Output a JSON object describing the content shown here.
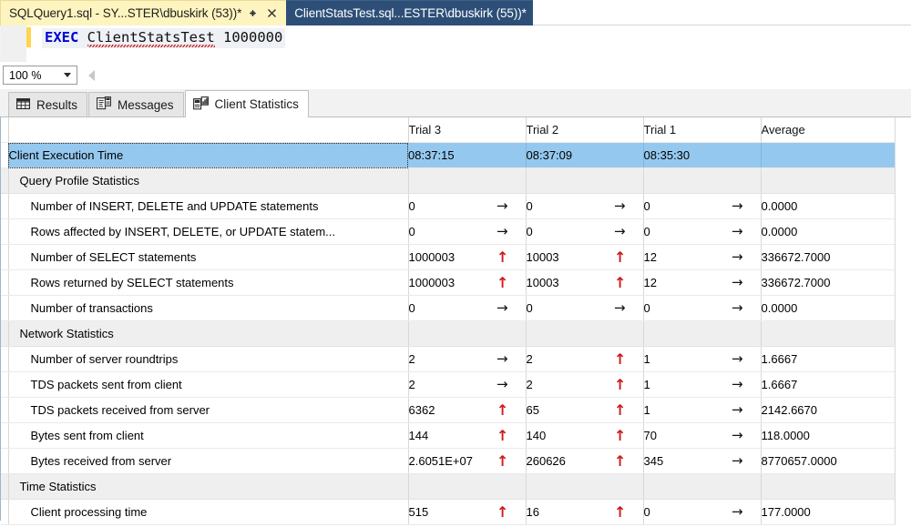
{
  "window": {
    "document_tabs": [
      {
        "title": "SQLQuery1.sql - SY...STER\\dbuskirk (53))*",
        "active": true,
        "pin_icon": "pin-icon",
        "close_icon": "close-icon"
      },
      {
        "title": "ClientStatsTest.sql...ESTER\\dbuskirk (55))*",
        "active": false
      }
    ]
  },
  "editor": {
    "keyword": "EXEC",
    "identifier": "ClientStatsTest",
    "argument": "1000000"
  },
  "toolbar": {
    "zoom_value": "100 %",
    "zoom_caret_icon": "chevron-down-icon",
    "scroll_left_icon": "scroll-left-icon"
  },
  "result_tabs": [
    {
      "label": "Results",
      "icon": "grid-icon",
      "selected": false
    },
    {
      "label": "Messages",
      "icon": "messages-icon",
      "selected": false
    },
    {
      "label": "Client Statistics",
      "icon": "client-statistics-icon",
      "selected": true
    }
  ],
  "grid": {
    "columns": [
      "",
      "Trial 3",
      "Trial 2",
      "Trial 1",
      "Average"
    ],
    "arrow_flat": "→",
    "arrow_up": "↑",
    "selected_color": "#95c8ef",
    "up_arrow_color": "#d01818",
    "rows": [
      {
        "type": "selected",
        "label": "Client Execution Time",
        "t3": "08:37:15",
        "a3": "",
        "t2": "08:37:09",
        "a2": "",
        "t1": "08:35:30",
        "a1": "",
        "avg": ""
      },
      {
        "type": "section",
        "label": "Query Profile Statistics",
        "t3": "",
        "a3": "",
        "t2": "",
        "a2": "",
        "t1": "",
        "a1": "",
        "avg": ""
      },
      {
        "type": "data",
        "label": "Number of INSERT, DELETE and UPDATE statements",
        "t3": "0",
        "a3": "flat",
        "t2": "0",
        "a2": "flat",
        "t1": "0",
        "a1": "flat",
        "avg": "0.0000"
      },
      {
        "type": "data",
        "label": "Rows affected by INSERT, DELETE, or UPDATE statem...",
        "t3": "0",
        "a3": "flat",
        "t2": "0",
        "a2": "flat",
        "t1": "0",
        "a1": "flat",
        "avg": "0.0000"
      },
      {
        "type": "data",
        "label": "Number of SELECT statements",
        "t3": "1000003",
        "a3": "up",
        "t2": "10003",
        "a2": "up",
        "t1": "12",
        "a1": "flat",
        "avg": "336672.7000"
      },
      {
        "type": "data",
        "label": "Rows returned by SELECT statements",
        "t3": "1000003",
        "a3": "up",
        "t2": "10003",
        "a2": "up",
        "t1": "12",
        "a1": "flat",
        "avg": "336672.7000"
      },
      {
        "type": "data",
        "label": "Number of transactions",
        "t3": "0",
        "a3": "flat",
        "t2": "0",
        "a2": "flat",
        "t1": "0",
        "a1": "flat",
        "avg": "0.0000"
      },
      {
        "type": "section",
        "label": "Network Statistics",
        "t3": "",
        "a3": "",
        "t2": "",
        "a2": "",
        "t1": "",
        "a1": "",
        "avg": ""
      },
      {
        "type": "data",
        "label": "Number of server roundtrips",
        "t3": "2",
        "a3": "flat",
        "t2": "2",
        "a2": "up",
        "t1": "1",
        "a1": "flat",
        "avg": "1.6667"
      },
      {
        "type": "data",
        "label": "TDS packets sent from client",
        "t3": "2",
        "a3": "flat",
        "t2": "2",
        "a2": "up",
        "t1": "1",
        "a1": "flat",
        "avg": "1.6667"
      },
      {
        "type": "data",
        "label": "TDS packets received from server",
        "t3": "6362",
        "a3": "up",
        "t2": "65",
        "a2": "up",
        "t1": "1",
        "a1": "flat",
        "avg": "2142.6670"
      },
      {
        "type": "data",
        "label": "Bytes sent from client",
        "t3": "144",
        "a3": "up",
        "t2": "140",
        "a2": "up",
        "t1": "70",
        "a1": "flat",
        "avg": "118.0000"
      },
      {
        "type": "data",
        "label": "Bytes received from server",
        "t3": "2.6051E+07",
        "a3": "up",
        "t2": "260626",
        "a2": "up",
        "t1": "345",
        "a1": "flat",
        "avg": "8770657.0000"
      },
      {
        "type": "section",
        "label": "Time Statistics",
        "t3": "",
        "a3": "",
        "t2": "",
        "a2": "",
        "t1": "",
        "a1": "",
        "avg": ""
      },
      {
        "type": "data",
        "label": "Client processing time",
        "t3": "515",
        "a3": "up",
        "t2": "16",
        "a2": "up",
        "t1": "0",
        "a1": "flat",
        "avg": "177.0000"
      }
    ]
  }
}
